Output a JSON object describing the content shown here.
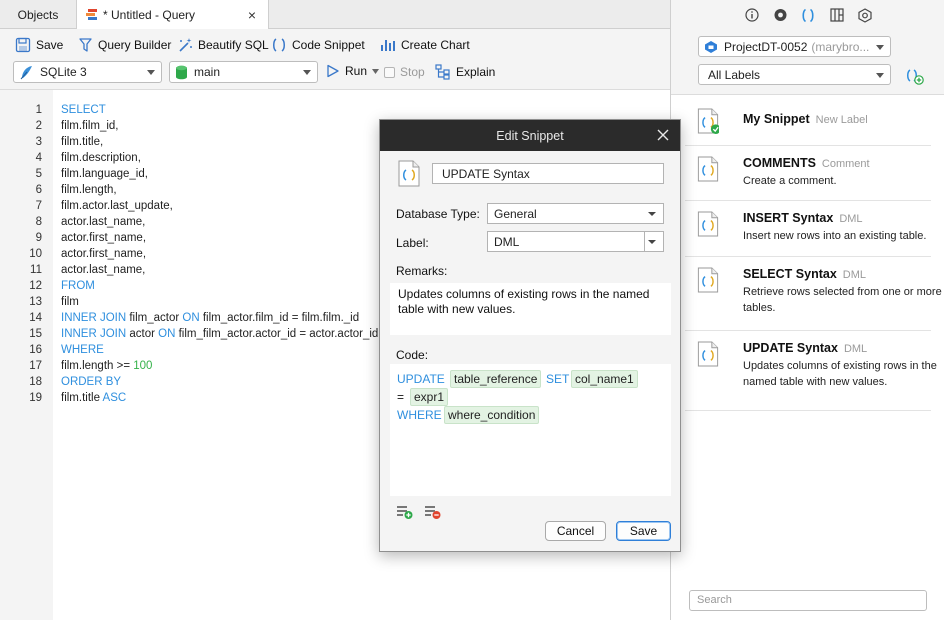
{
  "tabs": {
    "objects_label": "Objects",
    "query_label": "* Untitled - Query",
    "close_glyph": "×"
  },
  "toolbar": {
    "save": "Save",
    "query_builder": "Query Builder",
    "beautify_sql": "Beautify SQL",
    "code_snippet": "Code Snippet",
    "create_chart": "Create Chart",
    "connection": "SQLite 3",
    "database": "main",
    "run": "Run",
    "stop": "Stop",
    "explain": "Explain"
  },
  "editor": {
    "lines": [
      {
        "n": "1",
        "html": "<span class=\"kw\">SELECT</span>"
      },
      {
        "n": "2",
        "html": "film.film_id,"
      },
      {
        "n": "3",
        "html": "film.title,"
      },
      {
        "n": "4",
        "html": "film.description,"
      },
      {
        "n": "5",
        "html": "film.language_id,"
      },
      {
        "n": "6",
        "html": "film.length,"
      },
      {
        "n": "7",
        "html": "film.actor.last_update,"
      },
      {
        "n": "8",
        "html": "actor.last_name,"
      },
      {
        "n": "9",
        "html": "actor.first_name,"
      },
      {
        "n": "10",
        "html": "actor.first_name,"
      },
      {
        "n": "11",
        "html": "actor.last_name,"
      },
      {
        "n": "12",
        "html": "<span class=\"kw\">FROM</span>"
      },
      {
        "n": "13",
        "html": "film"
      },
      {
        "n": "14",
        "html": "<span class=\"kw\">INNER JOIN</span> film_actor <span class=\"kw\">ON</span> film_actor.film_id = film.film._id"
      },
      {
        "n": "15",
        "html": "<span class=\"kw\">INNER JOIN</span> actor <span class=\"kw\">ON</span> film_film_actor.actor_id = actor.actor_id"
      },
      {
        "n": "16",
        "html": "<span class=\"kw\">WHERE</span>"
      },
      {
        "n": "17",
        "html": "film.length &gt;= <span class=\"num\">100</span>"
      },
      {
        "n": "18",
        "html": "<span class=\"kw\">ORDER BY</span>"
      },
      {
        "n": "19",
        "html": "film.title <span class=\"kw\">ASC</span>"
      }
    ]
  },
  "right_panel": {
    "connection": "ProjectDT-0052",
    "connection_user": "(marybro...",
    "label_filter": "All Labels",
    "search_placeholder": "Search",
    "snippets": [
      {
        "title": "My Snippet",
        "label": "New Label",
        "desc": ""
      },
      {
        "title": "COMMENTS",
        "label": "Comment",
        "desc": "Create a comment."
      },
      {
        "title": "INSERT Syntax",
        "label": "DML",
        "desc": "Insert new rows into an existing table."
      },
      {
        "title": "SELECT Syntax",
        "label": "DML",
        "desc": "Retrieve rows selected from one or more tables."
      },
      {
        "title": "UPDATE Syntax",
        "label": "DML",
        "desc": "Updates columns of existing rows in the named table with new values."
      }
    ]
  },
  "dialog": {
    "title": "Edit Snippet",
    "name": "UPDATE Syntax",
    "db_type_label": "Database Type:",
    "db_type_value": "General",
    "label_label": "Label:",
    "label_value": "DML",
    "remarks_label": "Remarks:",
    "remarks": "Updates columns of existing rows in the named table with new values.",
    "code_label": "Code:",
    "code_tokens": {
      "update": "UPDATE",
      "table_reference": "table_reference",
      "set": "SET",
      "col_name1": "col_name1",
      "eq": "=",
      "expr1": "expr1",
      "where": "WHERE",
      "where_condition": "where_condition"
    },
    "cancel": "Cancel",
    "save": "Save"
  },
  "colors": {
    "keyword": "#2f8fde",
    "number": "#35b24a",
    "dialog_title_bg": "#2b2b2b",
    "accent": "#2f7fd8"
  }
}
